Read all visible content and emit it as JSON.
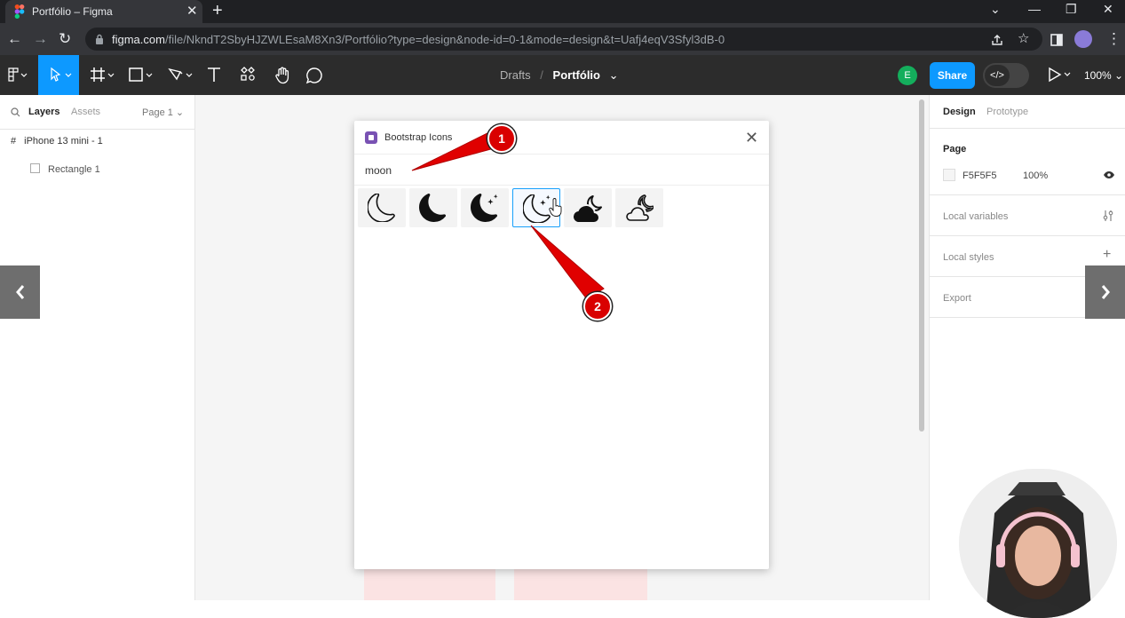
{
  "browser": {
    "tab_title": "Portfólio – Figma",
    "url_domain": "figma.com",
    "url_path": "/file/NkndT2SbyHJZWLEsaM8Xn3/Portfólio?type=design&node-id=0-1&mode=design&t=Uafj4eqV3Sfyl3dB-0"
  },
  "toolbar": {
    "breadcrumb_parent": "Drafts",
    "breadcrumb_sep": "/",
    "file_name": "Portfólio",
    "avatar_initial": "E",
    "share_label": "Share",
    "zoom_label": "100%"
  },
  "left_panel": {
    "tabs": [
      "Layers",
      "Assets"
    ],
    "page_selector": "Page 1",
    "layers": [
      {
        "name": "iPhone 13 mini - 1"
      },
      {
        "name": "Rectangle 1"
      }
    ]
  },
  "plugin": {
    "title": "Bootstrap Icons",
    "search_value": "moon",
    "icons": [
      "moon-icon",
      "moon-fill-icon",
      "moon-stars-fill-icon",
      "moon-stars-icon",
      "cloud-moon-fill-icon",
      "cloud-moon-icon"
    ],
    "selected_index": 3
  },
  "right_panel": {
    "tabs": [
      "Design",
      "Prototype"
    ],
    "page_heading": "Page",
    "page_color": "F5F5F5",
    "page_opacity": "100%",
    "local_variables": "Local variables",
    "local_styles": "Local styles",
    "export": "Export"
  },
  "annotations": {
    "badge1": "1",
    "badge2": "2"
  },
  "colors": {
    "accent": "#0d99ff",
    "annotation": "#d90000",
    "canvas": "#f5f5f5"
  }
}
